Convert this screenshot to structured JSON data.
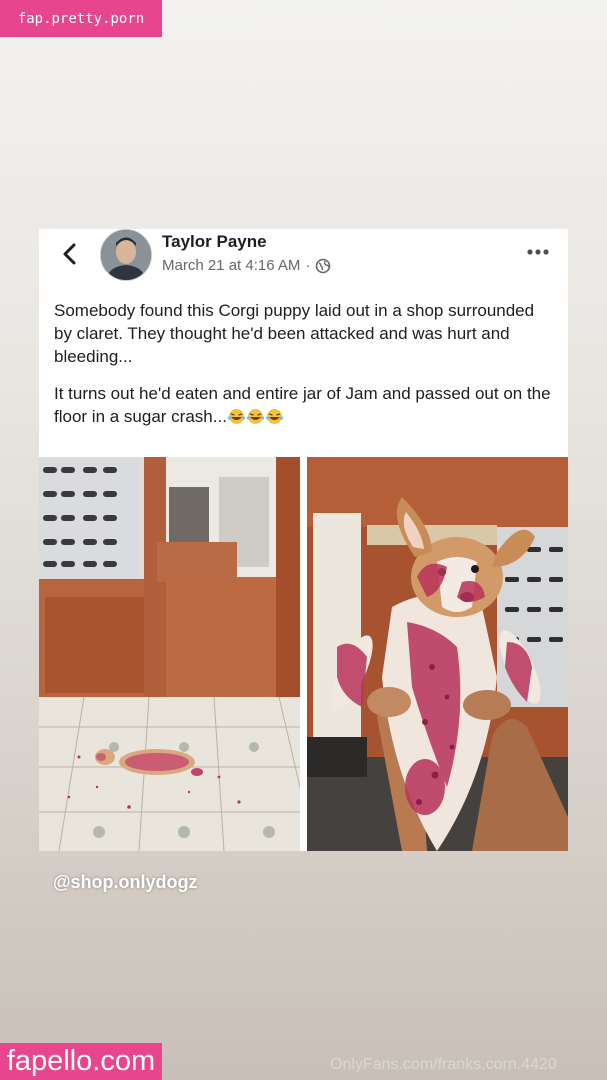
{
  "watermark_top": "fap.pretty.porn",
  "watermark_bottom": "fapello.com",
  "watermark_faint": "OnlyFans.com/franks.corn.4420",
  "post": {
    "author": "Taylor Payne",
    "timestamp": "March 21 at 4:16 AM",
    "separator": "·",
    "paragraph1": "Somebody found this Corgi puppy laid out in a shop surrounded by claret. They thought he'd been attacked and was hurt and bleeding...",
    "paragraph2": "It turns out he'd eaten and entire jar of Jam and passed out on the floor in a sugar crash...",
    "emoji": "😂😂😂"
  },
  "icons": {
    "back": "chevron-left-icon",
    "privacy": "globe-icon",
    "more": "more-horizontal-icon"
  },
  "credit_handle": "@shop.onlydogz",
  "colors": {
    "watermark_pink": "#e8458f",
    "jam_red": "#b8325a"
  }
}
